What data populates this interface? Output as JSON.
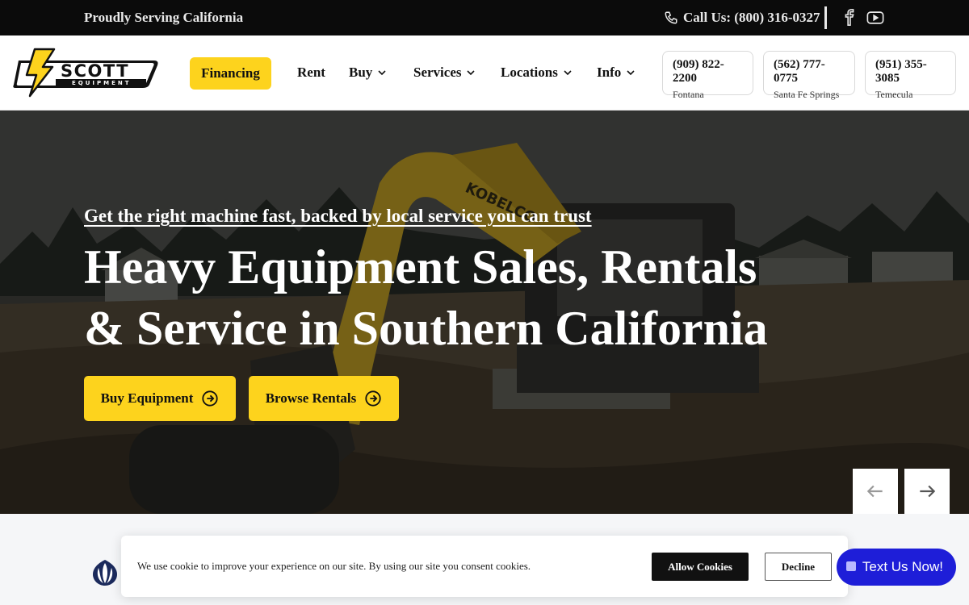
{
  "topbar": {
    "tagline": "Proudly Serving California",
    "call_label": "Call Us: (800) 316-0327",
    "social": [
      {
        "icon": "facebook-icon"
      },
      {
        "icon": "youtube-icon"
      }
    ]
  },
  "header": {
    "logo": {
      "line1": "SCOTT",
      "line2": "EQUIPMENT"
    },
    "financing_label": "Financing",
    "nav": [
      {
        "label": "Rent",
        "dropdown": false
      },
      {
        "label": "Buy",
        "dropdown": true
      },
      {
        "label": "Services",
        "dropdown": true
      },
      {
        "label": "Locations",
        "dropdown": true
      },
      {
        "label": "Info",
        "dropdown": true
      }
    ],
    "locations": [
      {
        "phone": "(909) 822-2200",
        "city": "Fontana"
      },
      {
        "phone": "(562) 777-0775",
        "city": "Santa Fe Springs"
      },
      {
        "phone": "(951) 355-3085",
        "city": "Temecula"
      }
    ]
  },
  "hero": {
    "eyebrow": "Get the right machine fast, backed by local service you can trust",
    "heading_line1": "Heavy Equipment Sales, Rentals",
    "heading_line2": "& Service in Southern California",
    "cta_buy": "Buy Equipment",
    "cta_rentals": "Browse Rentals",
    "machine_text": "KOBELCO",
    "prev_icon": "arrow-left-icon",
    "next_icon": "arrow-right-icon"
  },
  "cookie": {
    "message": "We use cookie to improve your experience on our site. By using our site you consent cookies.",
    "allow_label": "Allow Cookies",
    "decline_label": "Decline"
  },
  "chat": {
    "label": "Text Us Now!"
  },
  "colors": {
    "accent_yellow": "#fdd31d",
    "topbar_bg": "#0b0b0b",
    "chat_blue": "#1e1ed8"
  }
}
